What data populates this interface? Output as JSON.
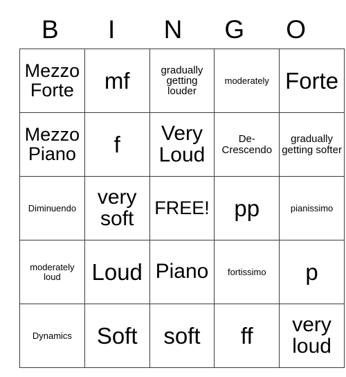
{
  "card": {
    "headers": [
      "B",
      "I",
      "N",
      "G",
      "O"
    ],
    "free_space_label": "FREE!",
    "rows": [
      [
        {
          "text": "Mezzo Forte",
          "size": "md"
        },
        {
          "text": "mf",
          "size": "xl"
        },
        {
          "text": "gradually getting louder",
          "size": "xs"
        },
        {
          "text": "moderately",
          "size": "xxs"
        },
        {
          "text": "Forte",
          "size": "xl"
        }
      ],
      [
        {
          "text": "Mezzo Piano",
          "size": "md"
        },
        {
          "text": "f",
          "size": "xl"
        },
        {
          "text": "Very Loud",
          "size": "lg"
        },
        {
          "text": "De-Crescendo",
          "size": "xs"
        },
        {
          "text": "gradually getting softer",
          "size": "xs"
        }
      ],
      [
        {
          "text": "Diminuendo",
          "size": "xxs"
        },
        {
          "text": "very soft",
          "size": "lg"
        },
        {
          "text": "FREE!",
          "size": "md"
        },
        {
          "text": "pp",
          "size": "xl"
        },
        {
          "text": "pianissimo",
          "size": "xxs"
        }
      ],
      [
        {
          "text": "moderately loud",
          "size": "xxs"
        },
        {
          "text": "Loud",
          "size": "xl"
        },
        {
          "text": "Piano",
          "size": "lg"
        },
        {
          "text": "fortissimo",
          "size": "xxs"
        },
        {
          "text": "p",
          "size": "xl"
        }
      ],
      [
        {
          "text": "Dynamics",
          "size": "xxs"
        },
        {
          "text": "Soft",
          "size": "xl"
        },
        {
          "text": "soft",
          "size": "xl"
        },
        {
          "text": "ff",
          "size": "xl"
        },
        {
          "text": "very loud",
          "size": "lg"
        }
      ]
    ]
  },
  "colors": {
    "border": "#3a3a3a",
    "text": "#000000",
    "background": "#ffffff"
  }
}
